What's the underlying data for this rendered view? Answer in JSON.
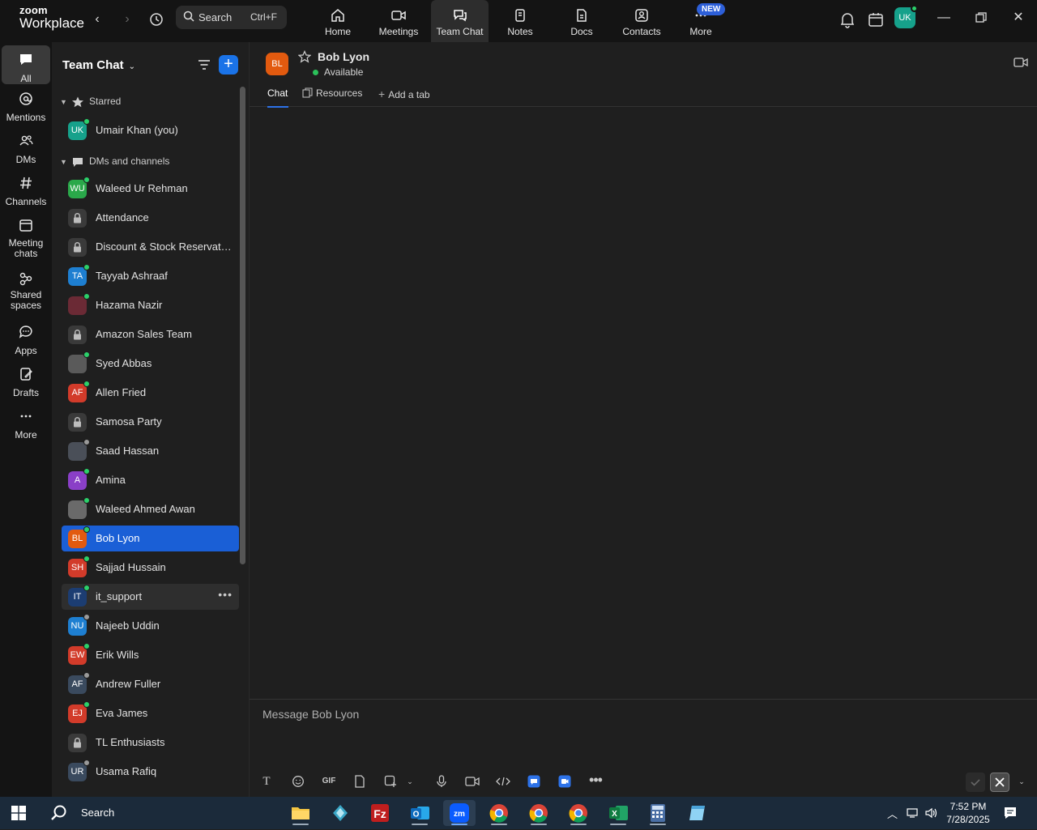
{
  "brand": {
    "line1": "zoom",
    "line2": "Workplace"
  },
  "search": {
    "label": "Search",
    "shortcut": "Ctrl+F"
  },
  "nav": {
    "tabs": [
      {
        "label": "Home"
      },
      {
        "label": "Meetings"
      },
      {
        "label": "Team Chat"
      },
      {
        "label": "Notes"
      },
      {
        "label": "Docs"
      },
      {
        "label": "Contacts"
      },
      {
        "label": "More"
      }
    ],
    "new_badge": "NEW",
    "active_tab": "Team Chat"
  },
  "user": {
    "initials": "UK"
  },
  "rail": {
    "items": [
      {
        "label": "All"
      },
      {
        "label": "Mentions"
      },
      {
        "label": "DMs"
      },
      {
        "label": "Channels"
      },
      {
        "label": "Meeting chats"
      },
      {
        "label": "Shared spaces"
      },
      {
        "label": "Apps"
      },
      {
        "label": "Drafts"
      },
      {
        "label": "More"
      }
    ]
  },
  "panel": {
    "title": "Team Chat",
    "starred_label": "Starred",
    "dms_label": "DMs and channels",
    "starred": [
      {
        "name": "Umair Khan (you)",
        "initials": "UK",
        "color": "#16a18b",
        "status": "#2bd06a"
      }
    ],
    "items": [
      {
        "name": "Waleed Ur Rehman",
        "initials": "WU",
        "color": "#2aa84a",
        "status": "#2bd06a"
      },
      {
        "name": "Attendance",
        "initials": "",
        "color": "#3a3a3a",
        "status": "",
        "lock": true
      },
      {
        "name": "Discount & Stock Reservati...",
        "initials": "",
        "color": "#3a3a3a",
        "status": "",
        "lock": true
      },
      {
        "name": "Tayyab Ashraaf",
        "initials": "TA",
        "color": "#1e7fd1",
        "status": "#2bd06a"
      },
      {
        "name": "Hazama Nazir",
        "initials": "",
        "color": "#6b2a35",
        "status": "#2bd06a",
        "photo": true
      },
      {
        "name": "Amazon Sales Team",
        "initials": "",
        "color": "#3a3a3a",
        "status": "",
        "lock": true
      },
      {
        "name": "Syed Abbas",
        "initials": "",
        "color": "#5a5a5a",
        "status": "#2bd06a",
        "photo": true
      },
      {
        "name": "Allen Fried",
        "initials": "AF",
        "color": "#d23b2a",
        "status": "#2bd06a"
      },
      {
        "name": "Samosa Party",
        "initials": "",
        "color": "#3a3a3a",
        "status": "",
        "lock": true
      },
      {
        "name": "Saad Hassan",
        "initials": "",
        "color": "#4a4f58",
        "status": "#9a9a9a",
        "photo": true
      },
      {
        "name": "Amina",
        "initials": "A",
        "color": "#8a3fc7",
        "status": "#2bd06a"
      },
      {
        "name": "Waleed Ahmed Awan",
        "initials": "",
        "color": "#6a6a6a",
        "status": "#2bd06a",
        "photo": true
      },
      {
        "name": "Bob Lyon",
        "initials": "BL",
        "color": "#e25a0f",
        "status": "#2bd06a",
        "selected": true
      },
      {
        "name": "Sajjad Hussain",
        "initials": "SH",
        "color": "#d23b2a",
        "status": "#2bd06a"
      },
      {
        "name": "it_support",
        "initials": "IT",
        "color": "#1c3d72",
        "status": "#2bd06a",
        "hover": true
      },
      {
        "name": "Najeeb Uddin",
        "initials": "NU",
        "color": "#1e7fd1",
        "status": "#9a9a9a"
      },
      {
        "name": "Erik Wills",
        "initials": "EW",
        "color": "#d23b2a",
        "status": "#2bd06a"
      },
      {
        "name": "Andrew Fuller",
        "initials": "AF",
        "color": "#3a4a5e",
        "status": "#9a9a9a"
      },
      {
        "name": "Eva James",
        "initials": "EJ",
        "color": "#d23b2a",
        "status": "#2bd06a"
      },
      {
        "name": "TL Enthusiasts",
        "initials": "",
        "color": "#3a3a3a",
        "status": "",
        "lock": true
      },
      {
        "name": "Usama Rafiq",
        "initials": "UR",
        "color": "#3a4a5e",
        "status": "#9a9a9a"
      }
    ]
  },
  "conversation": {
    "initials": "BL",
    "name": "Bob Lyon",
    "status": "Available",
    "tabs": [
      {
        "label": "Chat"
      },
      {
        "label": "Resources"
      },
      {
        "label": "Add a tab"
      }
    ],
    "composer_placeholder": "Message Bob Lyon",
    "gif_label": "GIF"
  },
  "taskbar": {
    "search_label": "Search",
    "time": "7:52 PM",
    "date": "7/28/2025"
  }
}
